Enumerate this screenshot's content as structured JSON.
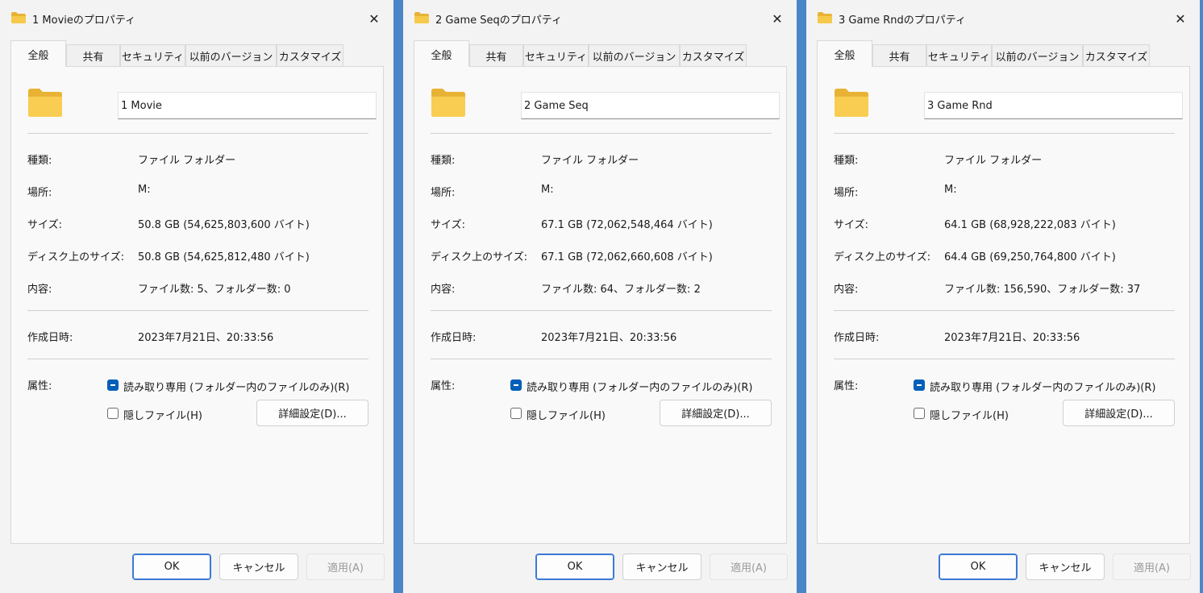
{
  "common": {
    "tabs": [
      "全般",
      "共有",
      "セキュリティ",
      "以前のバージョン",
      "カスタマイズ"
    ],
    "labels": {
      "type": "種類:",
      "location": "場所:",
      "size": "サイズ:",
      "size_on_disk": "ディスク上のサイズ:",
      "contains": "内容:",
      "created": "作成日時:",
      "attributes": "属性:"
    },
    "type_value": "ファイル フォルダー",
    "location_value": "M:",
    "readonly_label": "読み取り専用 (フォルダー内のファイルのみ)(R)",
    "hidden_label": "隠しファイル(H)",
    "advanced_label": "詳細設定(D)...",
    "ok_label": "OK",
    "cancel_label": "キャンセル",
    "apply_label": "適用(A)",
    "close_glyph": "✕",
    "colors": {
      "accent": "#005fb8",
      "folder": "#f6c94a",
      "desktop": "#4a86c8"
    }
  },
  "dialogs": [
    {
      "title": "1 Movieのプロパティ",
      "name": "1 Movie",
      "size": "50.8 GB (54,625,803,600 バイト)",
      "size_on_disk": "50.8 GB (54,625,812,480 バイト)",
      "contains": "ファイル数: 5、フォルダー数: 0",
      "created": "2023年7月21日、20:33:56"
    },
    {
      "title": "2 Game Seqのプロパティ",
      "name": "2 Game Seq",
      "size": "67.1 GB (72,062,548,464 バイト)",
      "size_on_disk": "67.1 GB (72,062,660,608 バイト)",
      "contains": "ファイル数: 64、フォルダー数: 2",
      "created": "2023年7月21日、20:33:56"
    },
    {
      "title": "3 Game Rndのプロパティ",
      "name": "3 Game Rnd",
      "size": "64.1 GB (68,928,222,083 バイト)",
      "size_on_disk": "64.4 GB (69,250,764,800 バイト)",
      "contains": "ファイル数: 156,590、フォルダー数: 37",
      "created": "2023年7月21日、20:33:56"
    }
  ]
}
